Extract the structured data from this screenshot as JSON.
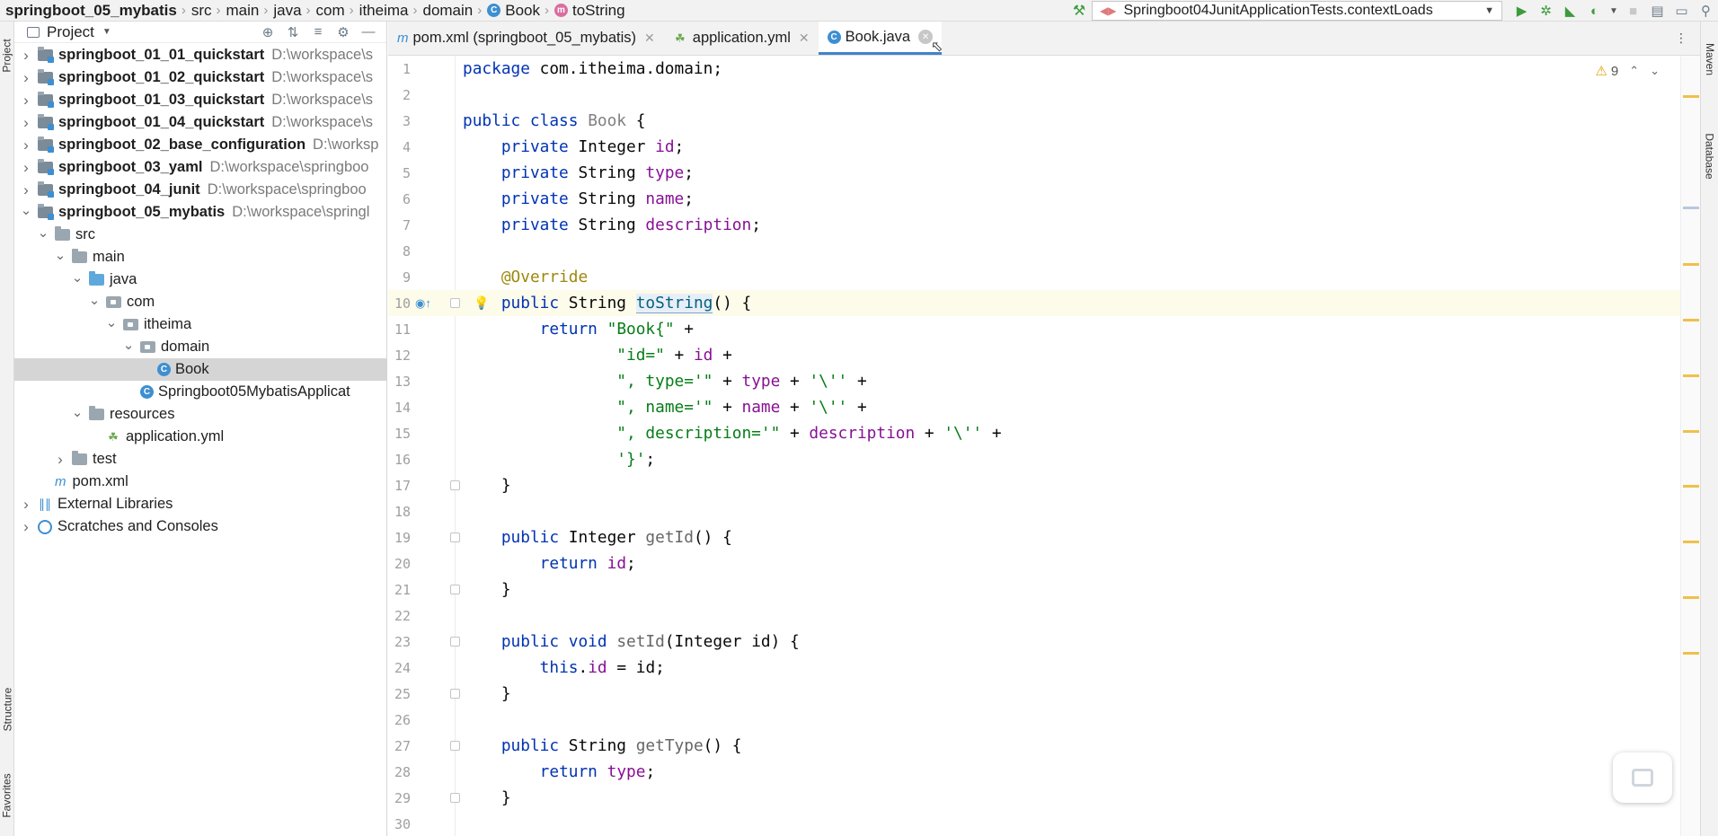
{
  "breadcrumbs": [
    {
      "label": "springboot_05_mybatis",
      "bold": true,
      "icon": ""
    },
    {
      "label": "src",
      "bold": false,
      "icon": ""
    },
    {
      "label": "main",
      "bold": false,
      "icon": ""
    },
    {
      "label": "java",
      "bold": false,
      "icon": ""
    },
    {
      "label": "com",
      "bold": false,
      "icon": ""
    },
    {
      "label": "itheima",
      "bold": false,
      "icon": ""
    },
    {
      "label": "domain",
      "bold": false,
      "icon": ""
    },
    {
      "label": "Book",
      "bold": false,
      "icon": "class-icon"
    },
    {
      "label": "toString",
      "bold": false,
      "icon": "method-icon"
    }
  ],
  "run_config": {
    "label": "Springboot04JunitApplicationTests.contextLoads"
  },
  "left_strip": {
    "project_tab": "Project",
    "structure_tab": "Structure",
    "favorites_tab": "Favorites"
  },
  "right_strip": {
    "maven_tab": "Maven",
    "database_tab": "Database"
  },
  "project_panel": {
    "title": "Project",
    "tree": [
      {
        "label": "springboot_01_01_quickstart",
        "path": "D:\\workspace\\s",
        "type": "module",
        "depth": 0,
        "expanded": false,
        "bold": true
      },
      {
        "label": "springboot_01_02_quickstart",
        "path": "D:\\workspace\\s",
        "type": "module",
        "depth": 0,
        "expanded": false,
        "bold": true
      },
      {
        "label": "springboot_01_03_quickstart",
        "path": "D:\\workspace\\s",
        "type": "module",
        "depth": 0,
        "expanded": false,
        "bold": true
      },
      {
        "label": "springboot_01_04_quickstart",
        "path": "D:\\workspace\\s",
        "type": "module",
        "depth": 0,
        "expanded": false,
        "bold": true
      },
      {
        "label": "springboot_02_base_configuration",
        "path": "D:\\worksp",
        "type": "module",
        "depth": 0,
        "expanded": false,
        "bold": true
      },
      {
        "label": "springboot_03_yaml",
        "path": "D:\\workspace\\springboo",
        "type": "module",
        "depth": 0,
        "expanded": false,
        "bold": true
      },
      {
        "label": "springboot_04_junit",
        "path": "D:\\workspace\\springboo",
        "type": "module",
        "depth": 0,
        "expanded": false,
        "bold": true
      },
      {
        "label": "springboot_05_mybatis",
        "path": "D:\\workspace\\springl",
        "type": "module",
        "depth": 0,
        "expanded": true,
        "bold": true
      },
      {
        "label": "src",
        "path": "",
        "type": "folder",
        "depth": 1,
        "expanded": true,
        "bold": false
      },
      {
        "label": "main",
        "path": "",
        "type": "folder",
        "depth": 2,
        "expanded": true,
        "bold": false
      },
      {
        "label": "java",
        "path": "",
        "type": "folder-blue",
        "depth": 3,
        "expanded": true,
        "bold": false
      },
      {
        "label": "com",
        "path": "",
        "type": "package",
        "depth": 4,
        "expanded": true,
        "bold": false
      },
      {
        "label": "itheima",
        "path": "",
        "type": "package",
        "depth": 5,
        "expanded": true,
        "bold": false
      },
      {
        "label": "domain",
        "path": "",
        "type": "package",
        "depth": 6,
        "expanded": true,
        "bold": false
      },
      {
        "label": "Book",
        "path": "",
        "type": "class",
        "depth": 7,
        "expanded": null,
        "bold": false,
        "selected": true
      },
      {
        "label": "Springboot05MybatisApplicat",
        "path": "",
        "type": "spring-class",
        "depth": 6,
        "expanded": null,
        "bold": false
      },
      {
        "label": "resources",
        "path": "",
        "type": "folder",
        "depth": 3,
        "expanded": true,
        "bold": false
      },
      {
        "label": "application.yml",
        "path": "",
        "type": "yml",
        "depth": 4,
        "expanded": null,
        "bold": false
      },
      {
        "label": "test",
        "path": "",
        "type": "folder",
        "depth": 2,
        "expanded": false,
        "bold": false
      },
      {
        "label": "pom.xml",
        "path": "",
        "type": "maven",
        "depth": 1,
        "expanded": null,
        "bold": false
      },
      {
        "label": "External Libraries",
        "path": "",
        "type": "libs",
        "depth": 0,
        "expanded": false,
        "bold": false
      },
      {
        "label": "Scratches and Consoles",
        "path": "",
        "type": "scratch",
        "depth": 0,
        "expanded": false,
        "bold": false
      }
    ]
  },
  "tabs": [
    {
      "label": "pom.xml (springboot_05_mybatis)",
      "icon": "maven-icon",
      "active": false
    },
    {
      "label": "application.yml",
      "icon": "spring-leaf-icon",
      "active": false
    },
    {
      "label": "Book.java",
      "icon": "class-icon",
      "active": true
    }
  ],
  "editor": {
    "warning_count": "9",
    "lines": [
      {
        "n": "1",
        "html": "<span class=\"kw\">package</span> com.itheima.domain;"
      },
      {
        "n": "2",
        "html": ""
      },
      {
        "n": "3",
        "html": "<span class=\"kw\">public class</span> <span class=\"cls\">Book</span> {"
      },
      {
        "n": "4",
        "html": "    <span class=\"kw\">private</span> Integer <span class=\"fld\">id</span>;"
      },
      {
        "n": "5",
        "html": "    <span class=\"kw\">private</span> String <span class=\"fld\">type</span>;"
      },
      {
        "n": "6",
        "html": "    <span class=\"kw\">private</span> String <span class=\"fld\">name</span>;"
      },
      {
        "n": "7",
        "html": "    <span class=\"kw\">private</span> String <span class=\"fld\">description</span>;"
      },
      {
        "n": "8",
        "html": ""
      },
      {
        "n": "9",
        "html": "    <span class=\"ann\">@Override</span>"
      },
      {
        "n": "10",
        "html": "    <span class=\"kw\">public</span> String <span class=\"caret\"></span><span class=\"mth sel-hl\">toString</span>() {"
      },
      {
        "n": "11",
        "html": "        <span class=\"kw\">return</span> <span class=\"str\">\"Book{\"</span> +"
      },
      {
        "n": "12",
        "html": "                <span class=\"str\">\"id=\"</span> + <span class=\"fld\">id</span> +"
      },
      {
        "n": "13",
        "html": "                <span class=\"str\">\", type='\"</span> + <span class=\"fld\">type</span> + <span class=\"str\">'\\''</span> +"
      },
      {
        "n": "14",
        "html": "                <span class=\"str\">\", name='\"</span> + <span class=\"fld\">name</span> + <span class=\"str\">'\\''</span> +"
      },
      {
        "n": "15",
        "html": "                <span class=\"str\">\", description='\"</span> + <span class=\"fld\">description</span> + <span class=\"str\">'\\''</span> +"
      },
      {
        "n": "16",
        "html": "                <span class=\"str\">'}'</span>;"
      },
      {
        "n": "17",
        "html": "    }"
      },
      {
        "n": "18",
        "html": ""
      },
      {
        "n": "19",
        "html": "    <span class=\"kw\">public</span> Integer <span class=\"mthg\">getId</span>() {"
      },
      {
        "n": "20",
        "html": "        <span class=\"kw\">return</span> <span class=\"fld\">id</span>;"
      },
      {
        "n": "21",
        "html": "    }"
      },
      {
        "n": "22",
        "html": ""
      },
      {
        "n": "23",
        "html": "    <span class=\"kw\">public void</span> <span class=\"mthg\">setId</span>(Integer id) {"
      },
      {
        "n": "24",
        "html": "        <span class=\"kw\">this</span>.<span class=\"fld\">id</span> = id;"
      },
      {
        "n": "25",
        "html": "    }"
      },
      {
        "n": "26",
        "html": ""
      },
      {
        "n": "27",
        "html": "    <span class=\"kw\">public</span> String <span class=\"mthg\">getType</span>() {"
      },
      {
        "n": "28",
        "html": "        <span class=\"kw\">return</span> <span class=\"fld\">type</span>;"
      },
      {
        "n": "29",
        "html": "    }"
      },
      {
        "n": "30",
        "html": ""
      }
    ]
  }
}
